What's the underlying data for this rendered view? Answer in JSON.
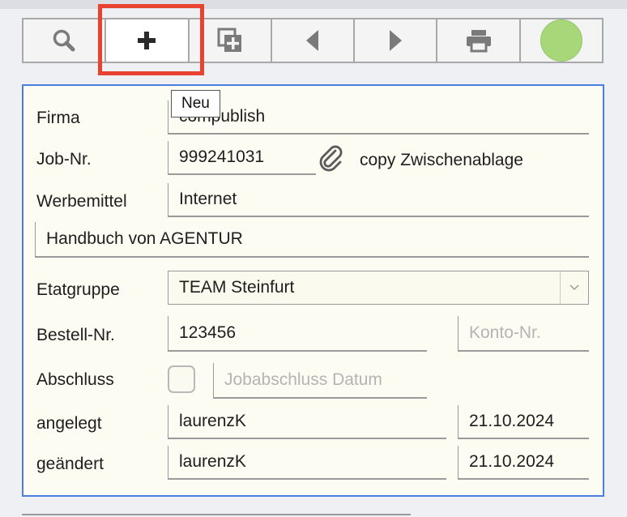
{
  "toolbar": {
    "buttons": [
      {
        "icon": "search-icon"
      },
      {
        "icon": "plus-icon"
      },
      {
        "icon": "duplicate-icon"
      },
      {
        "icon": "triangle-left-icon"
      },
      {
        "icon": "triangle-right-icon"
      },
      {
        "icon": "printer-icon"
      },
      {
        "icon": "status-dot",
        "color": "#a8d77a"
      }
    ],
    "tooltip": "Neu",
    "highlight_color": "#e84231"
  },
  "form": {
    "firma": {
      "label": "Firma",
      "value": "compublish"
    },
    "job": {
      "label": "Job-Nr.",
      "value": "999241031",
      "copy_label": "copy Zwischenablage"
    },
    "werbemittel": {
      "label": "Werbemittel",
      "value": "Internet"
    },
    "description": {
      "value": "Handbuch von AGENTUR"
    },
    "etatgruppe": {
      "label": "Etatgruppe",
      "value": "TEAM Steinfurt"
    },
    "bestell": {
      "label": "Bestell-Nr.",
      "value": "123456",
      "konto_placeholder": "Konto-Nr."
    },
    "abschluss": {
      "label": "Abschluss",
      "checked": false,
      "datum_placeholder": "Jobabschluss Datum"
    },
    "angelegt": {
      "label": "angelegt",
      "user": "laurenzK",
      "date": "21.10.2024"
    },
    "geaendert": {
      "label": "geändert",
      "user": "laurenzK",
      "date": "21.10.2024"
    }
  },
  "colors": {
    "card_border": "#4a7fe0",
    "card_bg": "#fdfcf2"
  }
}
